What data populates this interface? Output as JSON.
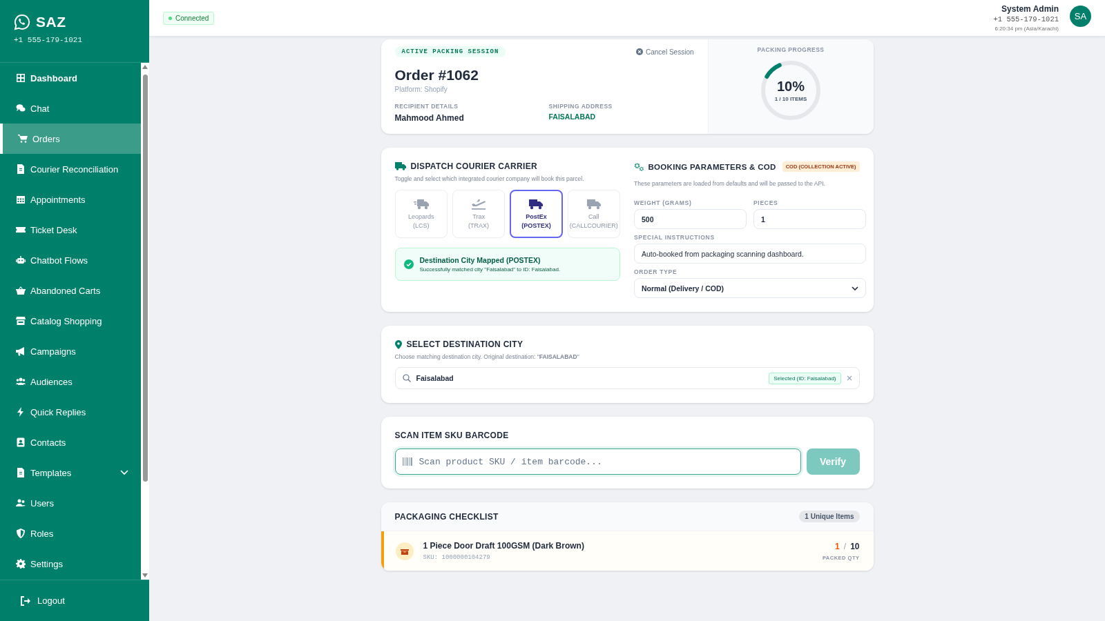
{
  "sidebar": {
    "brand": "SAZ",
    "phone": "+1 555-179-1021",
    "items": [
      {
        "label": "Dashboard",
        "selected": false,
        "kind": "link"
      },
      {
        "label": "Chat",
        "selected": false,
        "kind": "link"
      },
      {
        "label": "Orders",
        "selected": true,
        "kind": "link"
      },
      {
        "label": "Courier Reconciliation",
        "selected": false,
        "kind": "link"
      },
      {
        "label": "Appointments",
        "selected": false,
        "kind": "link"
      },
      {
        "label": "Ticket Desk",
        "selected": false,
        "kind": "link"
      },
      {
        "label": "Chatbot Flows",
        "selected": false,
        "kind": "link"
      },
      {
        "label": "Abandoned Carts",
        "selected": false,
        "kind": "link"
      },
      {
        "label": "Catalog Shopping",
        "selected": false,
        "kind": "link"
      },
      {
        "label": "Campaigns",
        "selected": false,
        "kind": "link"
      },
      {
        "label": "Audiences",
        "selected": false,
        "kind": "link"
      },
      {
        "label": "Quick Replies",
        "selected": false,
        "kind": "link"
      },
      {
        "label": "Contacts",
        "selected": false,
        "kind": "link"
      },
      {
        "label": "Templates",
        "selected": false,
        "kind": "group",
        "expanded": false
      },
      {
        "label": "Users",
        "selected": false,
        "kind": "link"
      },
      {
        "label": "Roles",
        "selected": false,
        "kind": "link"
      },
      {
        "label": "Settings",
        "selected": false,
        "kind": "link"
      }
    ],
    "logout": "Logout"
  },
  "header": {
    "status": "Connected",
    "user": {
      "name": "System Admin",
      "phone": "+1 555-179-1021",
      "time": "6:20:34 pm (Asia/Karachi)",
      "initials": "SA"
    }
  },
  "session": {
    "badge": "ACTIVE PACKING SESSION",
    "cancel": "Cancel Session",
    "order_title": "Order #1062",
    "platform": "Platform: Shopify",
    "recipient_label": "RECIPIENT DETAILS",
    "recipient": "Mahmood Ahmed",
    "address_label": "SHIPPING ADDRESS",
    "address": "FAISALABAD",
    "progress_label": "PACKING PROGRESS",
    "progress": {
      "percent": "10%",
      "items": "1 / 10 ITEMS",
      "level": 0.1
    }
  },
  "courier": {
    "title": "DISPATCH COURIER CARRIER",
    "subtitle": "Toggle and select which integrated courier company will book this parcel.",
    "carriers": [
      {
        "name": "Leopards",
        "code": "(LCS)",
        "kind": "fast-truck",
        "selected": false
      },
      {
        "name": "Trax",
        "code": "(TRAX)",
        "kind": "plane",
        "selected": false
      },
      {
        "name": "PostEx",
        "code": "(POSTEX)",
        "kind": "truck",
        "selected": true
      },
      {
        "name": "Call",
        "code": "(CALLCOURIER)",
        "kind": "truck",
        "selected": false
      }
    ],
    "mapping": {
      "title": "Destination City Mapped (POSTEX)",
      "message": "Successfully matched city \"Faisalabad\" to ID: Faisalabad."
    }
  },
  "booking": {
    "title": "BOOKING PARAMETERS & COD",
    "badge": "COD (COLLECTION ACTIVE)",
    "subtitle": "These parameters are loaded from defaults and will be passed to the API.",
    "weight": {
      "label": "WEIGHT (GRAMS)",
      "value": "500"
    },
    "pieces": {
      "label": "PIECES",
      "value": "1"
    },
    "instructions": {
      "label": "SPECIAL INSTRUCTIONS",
      "value": "Auto-booked from packaging scanning dashboard."
    },
    "order_type": {
      "label": "ORDER TYPE",
      "value": "Normal (Delivery / COD)"
    }
  },
  "destination": {
    "title": "SELECT DESTINATION CITY",
    "subtitle": "Choose matching destination city. Original destination: \"**FAISALABAD**\"",
    "value": "Faisalabad",
    "badge": "Selected (ID: Faisalabad)"
  },
  "scan": {
    "title": "SCAN ITEM SKU BARCODE",
    "placeholder": "Scan product SKU / item barcode...",
    "button": {
      "label": "Verify",
      "disabled": true
    }
  },
  "checklist": {
    "title": "PACKAGING CHECKLIST",
    "count": "1 Unique Items",
    "items": [
      {
        "name": "1 Piece Door Draft 100GSM (Dark Brown)",
        "sku": "SKU: 1000000104279",
        "packed": "1",
        "separator": "/",
        "total": "10",
        "qty_label": "PACKED QTY",
        "complete": false
      }
    ]
  }
}
